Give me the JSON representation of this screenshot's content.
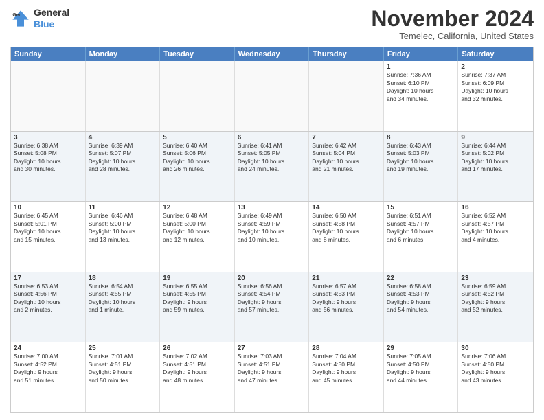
{
  "header": {
    "logo_line1": "General",
    "logo_line2": "Blue",
    "month": "November 2024",
    "location": "Temelec, California, United States"
  },
  "weekdays": [
    "Sunday",
    "Monday",
    "Tuesday",
    "Wednesday",
    "Thursday",
    "Friday",
    "Saturday"
  ],
  "rows": [
    [
      {
        "day": "",
        "info": "",
        "empty": true
      },
      {
        "day": "",
        "info": "",
        "empty": true
      },
      {
        "day": "",
        "info": "",
        "empty": true
      },
      {
        "day": "",
        "info": "",
        "empty": true
      },
      {
        "day": "",
        "info": "",
        "empty": true
      },
      {
        "day": "1",
        "info": "Sunrise: 7:36 AM\nSunset: 6:10 PM\nDaylight: 10 hours\nand 34 minutes.",
        "empty": false
      },
      {
        "day": "2",
        "info": "Sunrise: 7:37 AM\nSunset: 6:09 PM\nDaylight: 10 hours\nand 32 minutes.",
        "empty": false
      }
    ],
    [
      {
        "day": "3",
        "info": "Sunrise: 6:38 AM\nSunset: 5:08 PM\nDaylight: 10 hours\nand 30 minutes.",
        "empty": false
      },
      {
        "day": "4",
        "info": "Sunrise: 6:39 AM\nSunset: 5:07 PM\nDaylight: 10 hours\nand 28 minutes.",
        "empty": false
      },
      {
        "day": "5",
        "info": "Sunrise: 6:40 AM\nSunset: 5:06 PM\nDaylight: 10 hours\nand 26 minutes.",
        "empty": false
      },
      {
        "day": "6",
        "info": "Sunrise: 6:41 AM\nSunset: 5:05 PM\nDaylight: 10 hours\nand 24 minutes.",
        "empty": false
      },
      {
        "day": "7",
        "info": "Sunrise: 6:42 AM\nSunset: 5:04 PM\nDaylight: 10 hours\nand 21 minutes.",
        "empty": false
      },
      {
        "day": "8",
        "info": "Sunrise: 6:43 AM\nSunset: 5:03 PM\nDaylight: 10 hours\nand 19 minutes.",
        "empty": false
      },
      {
        "day": "9",
        "info": "Sunrise: 6:44 AM\nSunset: 5:02 PM\nDaylight: 10 hours\nand 17 minutes.",
        "empty": false
      }
    ],
    [
      {
        "day": "10",
        "info": "Sunrise: 6:45 AM\nSunset: 5:01 PM\nDaylight: 10 hours\nand 15 minutes.",
        "empty": false
      },
      {
        "day": "11",
        "info": "Sunrise: 6:46 AM\nSunset: 5:00 PM\nDaylight: 10 hours\nand 13 minutes.",
        "empty": false
      },
      {
        "day": "12",
        "info": "Sunrise: 6:48 AM\nSunset: 5:00 PM\nDaylight: 10 hours\nand 12 minutes.",
        "empty": false
      },
      {
        "day": "13",
        "info": "Sunrise: 6:49 AM\nSunset: 4:59 PM\nDaylight: 10 hours\nand 10 minutes.",
        "empty": false
      },
      {
        "day": "14",
        "info": "Sunrise: 6:50 AM\nSunset: 4:58 PM\nDaylight: 10 hours\nand 8 minutes.",
        "empty": false
      },
      {
        "day": "15",
        "info": "Sunrise: 6:51 AM\nSunset: 4:57 PM\nDaylight: 10 hours\nand 6 minutes.",
        "empty": false
      },
      {
        "day": "16",
        "info": "Sunrise: 6:52 AM\nSunset: 4:57 PM\nDaylight: 10 hours\nand 4 minutes.",
        "empty": false
      }
    ],
    [
      {
        "day": "17",
        "info": "Sunrise: 6:53 AM\nSunset: 4:56 PM\nDaylight: 10 hours\nand 2 minutes.",
        "empty": false
      },
      {
        "day": "18",
        "info": "Sunrise: 6:54 AM\nSunset: 4:55 PM\nDaylight: 10 hours\nand 1 minute.",
        "empty": false
      },
      {
        "day": "19",
        "info": "Sunrise: 6:55 AM\nSunset: 4:55 PM\nDaylight: 9 hours\nand 59 minutes.",
        "empty": false
      },
      {
        "day": "20",
        "info": "Sunrise: 6:56 AM\nSunset: 4:54 PM\nDaylight: 9 hours\nand 57 minutes.",
        "empty": false
      },
      {
        "day": "21",
        "info": "Sunrise: 6:57 AM\nSunset: 4:53 PM\nDaylight: 9 hours\nand 56 minutes.",
        "empty": false
      },
      {
        "day": "22",
        "info": "Sunrise: 6:58 AM\nSunset: 4:53 PM\nDaylight: 9 hours\nand 54 minutes.",
        "empty": false
      },
      {
        "day": "23",
        "info": "Sunrise: 6:59 AM\nSunset: 4:52 PM\nDaylight: 9 hours\nand 52 minutes.",
        "empty": false
      }
    ],
    [
      {
        "day": "24",
        "info": "Sunrise: 7:00 AM\nSunset: 4:52 PM\nDaylight: 9 hours\nand 51 minutes.",
        "empty": false
      },
      {
        "day": "25",
        "info": "Sunrise: 7:01 AM\nSunset: 4:51 PM\nDaylight: 9 hours\nand 50 minutes.",
        "empty": false
      },
      {
        "day": "26",
        "info": "Sunrise: 7:02 AM\nSunset: 4:51 PM\nDaylight: 9 hours\nand 48 minutes.",
        "empty": false
      },
      {
        "day": "27",
        "info": "Sunrise: 7:03 AM\nSunset: 4:51 PM\nDaylight: 9 hours\nand 47 minutes.",
        "empty": false
      },
      {
        "day": "28",
        "info": "Sunrise: 7:04 AM\nSunset: 4:50 PM\nDaylight: 9 hours\nand 45 minutes.",
        "empty": false
      },
      {
        "day": "29",
        "info": "Sunrise: 7:05 AM\nSunset: 4:50 PM\nDaylight: 9 hours\nand 44 minutes.",
        "empty": false
      },
      {
        "day": "30",
        "info": "Sunrise: 7:06 AM\nSunset: 4:50 PM\nDaylight: 9 hours\nand 43 minutes.",
        "empty": false
      }
    ]
  ]
}
